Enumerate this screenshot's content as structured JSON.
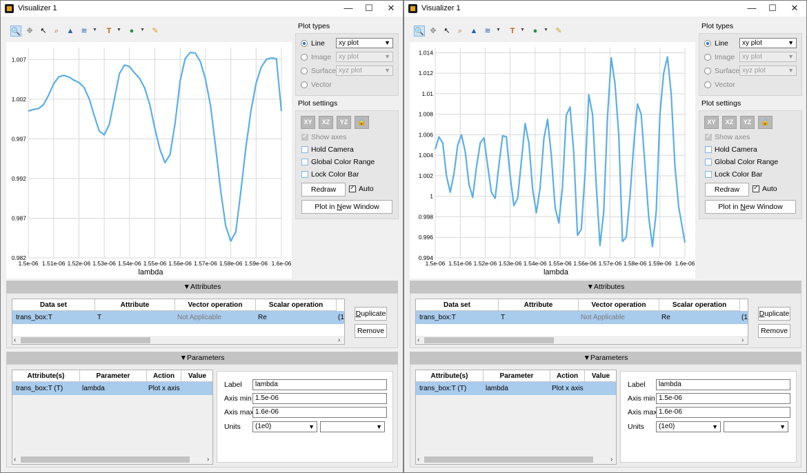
{
  "windows": [
    {
      "title": "Visualizer 1",
      "window_controls": {
        "minimize": "—",
        "maximize": "☐",
        "close": "✕"
      },
      "toolbar": {
        "icons": [
          "zoom-icon",
          "pan-icon",
          "pointer-icon",
          "zoom-box-icon",
          "mountain-icon",
          "lines-icon",
          "text-icon",
          "marker-icon",
          "pencil-icon"
        ]
      },
      "plot_types": {
        "title": "Plot types",
        "options": [
          {
            "label": "Line",
            "combo": "xy plot",
            "selected": true
          },
          {
            "label": "Image",
            "combo": "xy plot",
            "selected": false
          },
          {
            "label": "Surface",
            "combo": "xyz plot",
            "selected": false
          },
          {
            "label": "Vector",
            "combo": "",
            "selected": false
          }
        ]
      },
      "plot_settings": {
        "title": "Plot settings",
        "view_buttons": [
          "XY",
          "XZ",
          "YZ"
        ],
        "checks": [
          {
            "label": "Show axes",
            "checked": true,
            "disabled": true
          },
          {
            "label": "Hold Camera",
            "checked": false,
            "disabled": false
          },
          {
            "label": "Global Color Range",
            "checked": false,
            "disabled": false
          },
          {
            "label": "Lock Color Bar",
            "checked": false,
            "disabled": false
          }
        ],
        "redraw": "Redraw",
        "auto": "Auto",
        "plot_new_window_pre": "Plot in ",
        "plot_new_window_n": "N",
        "plot_new_window_post": "ew Window"
      },
      "attributes": {
        "header": "▼Attributes",
        "columns": [
          "Data set",
          "Attribute",
          "Vector operation",
          "Scalar operation"
        ],
        "row": [
          "trans_box:T",
          "T",
          "Not Applicable",
          "Re",
          "(1"
        ],
        "duplicate_pre": "",
        "duplicate_u": "D",
        "duplicate_post": "uplicate",
        "remove": "Remove"
      },
      "parameters": {
        "header": "▼Parameters",
        "columns": [
          "Attribute(s)",
          "Parameter",
          "Action",
          "Value"
        ],
        "row": [
          "trans_box:T (T)",
          "lambda",
          "Plot x axis"
        ],
        "label_lbl": "Label",
        "label_val": "lambda",
        "axis_min_lbl": "Axis min",
        "axis_min_val": "1.5e-06",
        "axis_max_lbl": "Axis max",
        "axis_max_val": "1.6e-06",
        "units_lbl": "Units",
        "units_val": "(1e0)",
        "units_val2": ""
      }
    },
    {
      "title": "Visualizer 1",
      "window_controls": {
        "minimize": "—",
        "maximize": "☐",
        "close": "✕"
      },
      "toolbar": {
        "icons": [
          "zoom-icon",
          "pan-icon",
          "pointer-icon",
          "zoom-box-icon",
          "mountain-icon",
          "lines-icon",
          "text-icon",
          "marker-icon",
          "pencil-icon"
        ]
      },
      "plot_types": {
        "title": "Plot types",
        "options": [
          {
            "label": "Line",
            "combo": "xy plot",
            "selected": true
          },
          {
            "label": "Image",
            "combo": "xy plot",
            "selected": false
          },
          {
            "label": "Surface",
            "combo": "xyz plot",
            "selected": false
          },
          {
            "label": "Vector",
            "combo": "",
            "selected": false
          }
        ]
      },
      "plot_settings": {
        "title": "Plot settings",
        "view_buttons": [
          "XY",
          "XZ",
          "YZ"
        ],
        "checks": [
          {
            "label": "Show axes",
            "checked": true,
            "disabled": true
          },
          {
            "label": "Hold Camera",
            "checked": false,
            "disabled": false
          },
          {
            "label": "Global Color Range",
            "checked": false,
            "disabled": false
          },
          {
            "label": "Lock Color Bar",
            "checked": false,
            "disabled": false
          }
        ],
        "redraw": "Redraw",
        "auto": "Auto",
        "plot_new_window_pre": "Plot in ",
        "plot_new_window_n": "N",
        "plot_new_window_post": "ew Window"
      },
      "attributes": {
        "header": "▼Attributes",
        "columns": [
          "Data set",
          "Attribute",
          "Vector operation",
          "Scalar operation"
        ],
        "row": [
          "trans_box:T",
          "T",
          "Not Applicable",
          "Re",
          "(1"
        ],
        "duplicate_pre": "",
        "duplicate_u": "D",
        "duplicate_post": "uplicate",
        "remove": "Remove"
      },
      "parameters": {
        "header": "▼Parameters",
        "columns": [
          "Attribute(s)",
          "Parameter",
          "Action",
          "Value"
        ],
        "row": [
          "trans_box:T (T)",
          "lambda",
          "Plot x axis"
        ],
        "label_lbl": "Label",
        "label_val": "lambda",
        "axis_min_lbl": "Axis min",
        "axis_min_val": "1.5e-06",
        "axis_max_lbl": "Axis max",
        "axis_max_val": "1.6e-06",
        "units_lbl": "Units",
        "units_val": "(1e0)",
        "units_val2": ""
      }
    }
  ],
  "chart_data": [
    {
      "type": "line",
      "xlabel": "lambda",
      "ylabel": "",
      "xlim": [
        1.5e-06,
        1.6e-06
      ],
      "ylim": [
        0.982,
        0.00875
      ],
      "xticks": [
        "1.5e-06",
        "1.51e-06",
        "1.52e-06",
        "1.53e-06",
        "1.54e-06",
        "1.55e-06",
        "1.56e-06",
        "1.57e-06",
        "1.58e-06",
        "1.59e-06",
        "1.6e-06"
      ],
      "yticks": [
        "0.982",
        "0.987",
        "0.992",
        "0.997",
        "1.002",
        "1.007"
      ],
      "ytick_values": [
        0.982,
        0.987,
        0.992,
        0.997,
        1.002,
        1.007
      ],
      "ymin": 0.982,
      "ymax": 1.0085,
      "color": "#5aaee8",
      "x": [
        1.5,
        1.502,
        1.504,
        1.506,
        1.508,
        1.51,
        1.512,
        1.514,
        1.516,
        1.518,
        1.52,
        1.522,
        1.524,
        1.526,
        1.528,
        1.53,
        1.532,
        1.534,
        1.536,
        1.538,
        1.54,
        1.542,
        1.544,
        1.546,
        1.548,
        1.55,
        1.552,
        1.554,
        1.556,
        1.558,
        1.56,
        1.562,
        1.564,
        1.566,
        1.568,
        1.57,
        1.572,
        1.574,
        1.576,
        1.578,
        1.58,
        1.582,
        1.584,
        1.586,
        1.588,
        1.59,
        1.592,
        1.594,
        1.596,
        1.598,
        1.6
      ],
      "values": [
        1.0005,
        1.0007,
        1.0008,
        1.0013,
        1.0025,
        1.0039,
        1.0048,
        1.005,
        1.0048,
        1.0044,
        1.0041,
        1.0035,
        1.0021,
        1.0,
        0.998,
        0.9975,
        0.9988,
        1.002,
        1.0052,
        1.0063,
        1.0061,
        1.0053,
        1.0046,
        1.0034,
        1.0013,
        0.9983,
        0.9957,
        0.994,
        0.995,
        0.999,
        1.0043,
        1.0071,
        1.0079,
        1.0078,
        1.0067,
        1.0045,
        1.0012,
        0.996,
        0.9905,
        0.986,
        0.9841,
        0.9853,
        0.9905,
        0.996,
        1.0006,
        1.004,
        1.006,
        1.007,
        1.0072,
        1.0071,
        1.0005
      ]
    },
    {
      "type": "line",
      "xlabel": "lambda",
      "ylabel": "",
      "xlim": [
        1.5e-06,
        1.6e-06
      ],
      "xticks": [
        "1.5e-06",
        "1.51e-06",
        "1.52e-06",
        "1.53e-06",
        "1.54e-06",
        "1.55e-06",
        "1.56e-06",
        "1.57e-06",
        "1.58e-06",
        "1.59e-06",
        "1.6e-06"
      ],
      "yticks": [
        "0.994",
        "0.996",
        "0.998",
        "1",
        "1.002",
        "1.004",
        "1.006",
        "1.008",
        "1.01",
        "1.012",
        "1.014"
      ],
      "ytick_values": [
        0.994,
        0.996,
        0.998,
        1.0,
        1.002,
        1.004,
        1.006,
        1.008,
        1.01,
        1.012,
        1.014
      ],
      "ymin": 0.994,
      "ymax": 1.0145,
      "color": "#5aaee8",
      "x": [
        1.5,
        1.5015,
        1.503,
        1.5045,
        1.506,
        1.5075,
        1.509,
        1.5105,
        1.512,
        1.5135,
        1.515,
        1.5165,
        1.518,
        1.5195,
        1.521,
        1.5225,
        1.524,
        1.5255,
        1.527,
        1.5285,
        1.53,
        1.5315,
        1.533,
        1.5345,
        1.536,
        1.5375,
        1.539,
        1.5405,
        1.542,
        1.5435,
        1.545,
        1.5465,
        1.548,
        1.5495,
        1.551,
        1.5525,
        1.554,
        1.5555,
        1.557,
        1.5585,
        1.56,
        1.5615,
        1.563,
        1.5645,
        1.566,
        1.5675,
        1.569,
        1.5705,
        1.572,
        1.5735,
        1.575,
        1.5765,
        1.578,
        1.5795,
        1.581,
        1.5825,
        1.584,
        1.5855,
        1.587,
        1.5885,
        1.59,
        1.5915,
        1.593,
        1.5945,
        1.596,
        1.5975,
        1.6
      ],
      "values": [
        1.0046,
        1.0058,
        1.0052,
        1.002,
        1.0004,
        1.0022,
        1.005,
        1.006,
        1.0044,
        1.0012,
        0.9999,
        1.0028,
        1.0052,
        1.0057,
        1.003,
        1.0004,
        0.9998,
        1.003,
        1.0059,
        1.0058,
        1.002,
        0.9991,
        0.9998,
        1.0034,
        1.0071,
        1.0052,
        1.0007,
        0.9984,
        1.0008,
        1.0056,
        1.0075,
        1.004,
        0.9989,
        0.9974,
        1.001,
        1.0079,
        1.0087,
        1.0042,
        0.9962,
        0.9968,
        1.0022,
        1.0099,
        1.008,
        1.001,
        0.9952,
        0.9985,
        1.0078,
        1.0135,
        1.011,
        1.006,
        0.9956,
        0.996,
        1.0,
        1.005,
        1.009,
        1.008,
        1.003,
        0.998,
        0.9951,
        0.9985,
        1.008,
        1.012,
        1.0136,
        1.01,
        1.003,
        0.999,
        0.9955
      ]
    }
  ]
}
